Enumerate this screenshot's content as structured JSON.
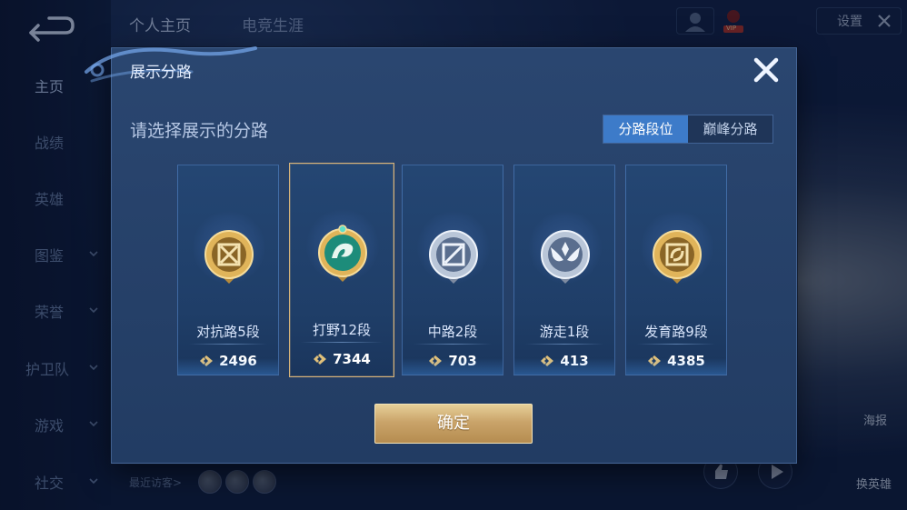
{
  "sidebar": {
    "items": [
      {
        "label": "主页"
      },
      {
        "label": "战绩"
      },
      {
        "label": "英雄"
      },
      {
        "label": "图鉴"
      },
      {
        "label": "荣誉"
      },
      {
        "label": "护卫队"
      },
      {
        "label": "游戏"
      },
      {
        "label": "社交"
      }
    ]
  },
  "header": {
    "tabs": [
      {
        "label": "个人主页"
      },
      {
        "label": "电竞生涯"
      }
    ],
    "vip_badge": "VIP",
    "right_button_label": "设置"
  },
  "bottom": {
    "recent_visitors": "最近访客>"
  },
  "right_side": {
    "label_1": "海报",
    "label_2": "换英雄"
  },
  "modal": {
    "title": "展示分路",
    "prompt": "请选择展示的分路",
    "tabs": [
      {
        "label": "分路段位",
        "active": true
      },
      {
        "label": "巅峰分路",
        "active": false
      }
    ],
    "cards": [
      {
        "name": "对抗路5段",
        "score": "2496",
        "icon": "clash-lane-badge-icon",
        "selected": false
      },
      {
        "name": "打野12段",
        "score": "7344",
        "icon": "jungle-dragon-badge-icon",
        "selected": true
      },
      {
        "name": "中路2段",
        "score": "703",
        "icon": "mid-lane-badge-icon",
        "selected": false
      },
      {
        "name": "游走1段",
        "score": "413",
        "icon": "roam-wings-badge-icon",
        "selected": false
      },
      {
        "name": "发育路9段",
        "score": "4385",
        "icon": "farm-lane-badge-icon",
        "selected": false
      }
    ],
    "confirm_label": "确定"
  },
  "colors": {
    "accent_blue": "#3d7bc9",
    "gold": "#d8b47a",
    "modal_bg": "#2a4670"
  }
}
